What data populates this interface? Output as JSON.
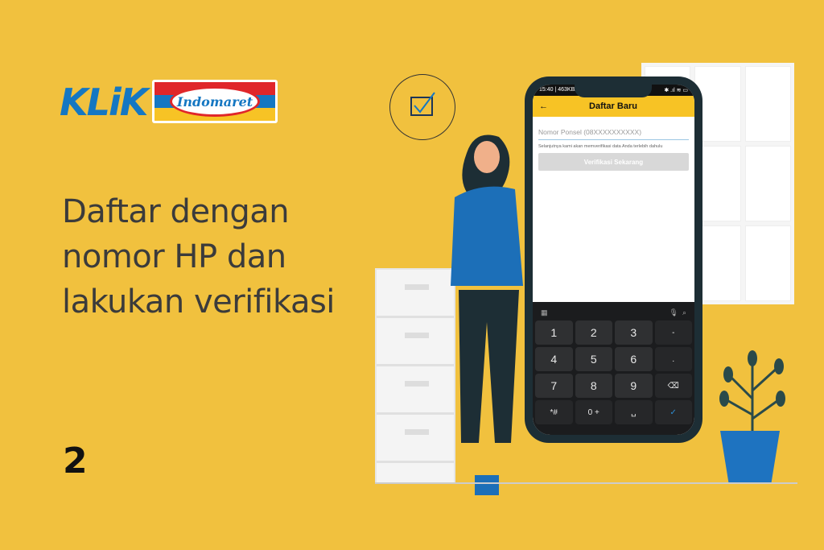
{
  "brand": {
    "klik": "KLiK",
    "indomaret": "Indomaret",
    "colors": {
      "blue": "#1577C2",
      "red": "#E0262A",
      "yellow": "#F7C325"
    }
  },
  "headline": [
    "Daftar dengan",
    "nomor HP dan",
    "lakukan verifikasi"
  ],
  "step_number": "2",
  "phone": {
    "status_left": "15:40 | 463KB/d",
    "status_right": "✱ .ıl ≋ ▭",
    "app_bar": {
      "back_icon": "arrow-left",
      "title": "Daftar Baru"
    },
    "phone_input": {
      "placeholder": "Nomor Ponsel (08XXXXXXXXXX)",
      "value": ""
    },
    "hint": "Selanjutnya kami akan memverifikasi data Anda terlebih dahulu",
    "verify_button": "Verifikasi Sekarang",
    "keyboard": {
      "keys": [
        "1",
        "2",
        "3",
        "-",
        "4",
        "5",
        "6",
        ".",
        "7",
        "8",
        "9",
        "⌫",
        "*#",
        "0 +",
        "␣",
        "✓"
      ]
    }
  }
}
